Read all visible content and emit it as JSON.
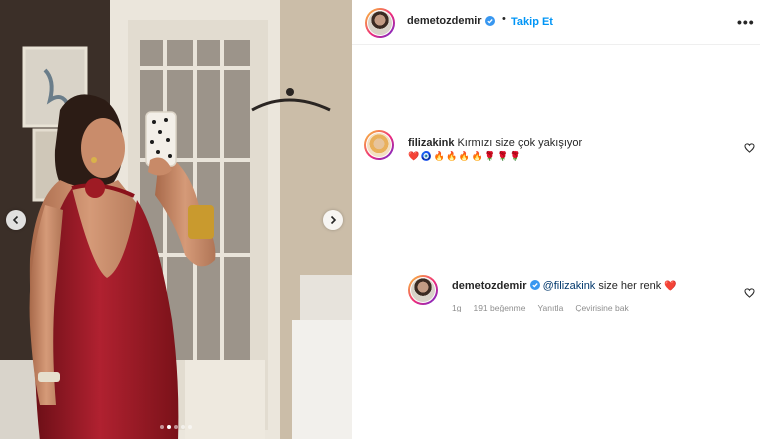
{
  "post": {
    "author": "demetozdemir",
    "separator": "•",
    "follow_label": "Takip Et",
    "more_label": "•••",
    "carousel": {
      "slide_count": 5,
      "active_index": 1
    }
  },
  "comments": [
    {
      "username": "filizakink",
      "text": "Kırmızı size çok yakışıyor",
      "emojis": [
        "❤️",
        "🧿",
        "🔥",
        "🔥",
        "🔥",
        "🔥",
        "🌹",
        "🌹",
        "🌹"
      ]
    }
  ],
  "reply": {
    "username": "demetozdemir",
    "mention": "@filizakink",
    "text": "size her renk",
    "emoji": "❤️",
    "meta": {
      "time": "1g",
      "likes": "191 beğenme",
      "reply": "Yanıtla",
      "translate": "Çevirisine bak"
    }
  },
  "colors": {
    "accent": "#0095f6",
    "verified": "#3897f0",
    "heart": "#ed4956",
    "dress": "#9e1b24"
  }
}
